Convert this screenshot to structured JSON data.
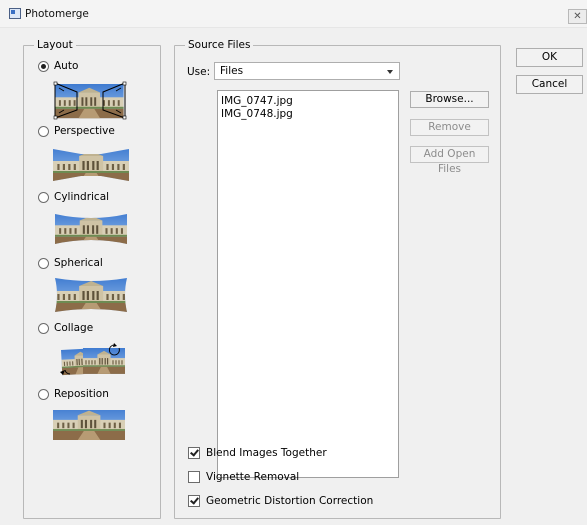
{
  "window": {
    "title": "Photomerge",
    "close_glyph": "✕"
  },
  "layout": {
    "legend": "Layout",
    "options": [
      {
        "label": "Auto",
        "selected": true
      },
      {
        "label": "Perspective",
        "selected": false
      },
      {
        "label": "Cylindrical",
        "selected": false
      },
      {
        "label": "Spherical",
        "selected": false
      },
      {
        "label": "Collage",
        "selected": false
      },
      {
        "label": "Reposition",
        "selected": false
      }
    ]
  },
  "source": {
    "legend": "Source Files",
    "use_label": "Use:",
    "use_value": "Files",
    "files": [
      "IMG_0747.jpg",
      "IMG_0748.jpg"
    ],
    "browse_label": "Browse...",
    "remove_label": "Remove",
    "add_open_label": "Add Open Files"
  },
  "options": {
    "blend": {
      "label": "Blend Images Together",
      "checked": true
    },
    "vignette": {
      "label": "Vignette Removal",
      "checked": false
    },
    "geometric": {
      "label": "Geometric Distortion Correction",
      "checked": true
    }
  },
  "actions": {
    "ok_label": "OK",
    "cancel_label": "Cancel"
  },
  "colors": {
    "sky": "#5b8fd6",
    "building": "#d7cdb3",
    "ground": "#8a6a48"
  }
}
